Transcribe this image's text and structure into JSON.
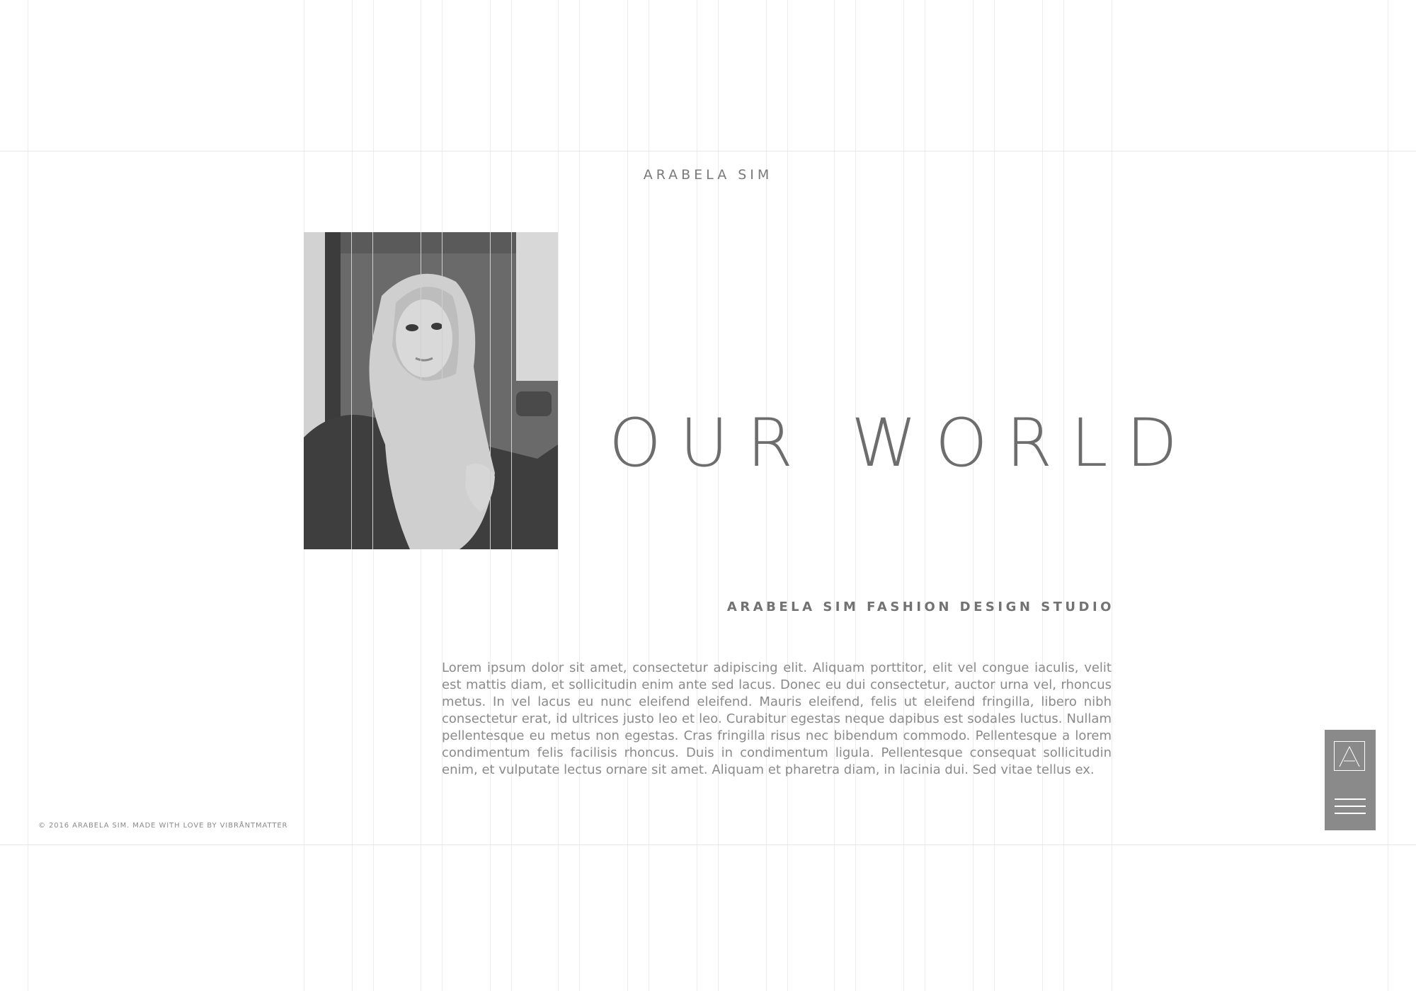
{
  "site": {
    "name": "ARABELA SIM"
  },
  "hero": {
    "headline": "OUR WORLD",
    "subheading": "ARABELA SIM FASHION DESIGN STUDIO",
    "body": "Lorem ipsum dolor sit amet, consectetur adipiscing elit. Aliquam porttitor, elit vel congue iaculis, velit est mattis diam, et sollicitudin enim ante sed lacus. Donec eu dui consectetur, auctor urna vel, rhoncus metus. In vel lacus eu nunc eleifend eleifend. Mauris eleifend, felis ut eleifend fringilla, libero nibh consectetur erat, id ultrices justo leo et leo. Curabitur egestas neque dapibus est sodales luctus. Nullam pellentesque eu metus non egestas. Cras fringilla risus nec bibendum commodo. Pellentesque a lorem condimentum felis facilisis rhoncus. Duis in condimentum ligula. Pellentesque consequat sollicitudin enim, et vulputate lectus ornare sit amet. Aliquam et pharetra diam, in lacinia dui. Sed vitae tellus ex."
  },
  "footer": {
    "copyright": "© 2016 ARABELA SIM. MADE WITH LOVE BY VIBRÅNTMATTER"
  },
  "menu_widget": {
    "logo_icon": "triangle-a-logo-icon",
    "menu_icon": "hamburger-menu-icon"
  },
  "colors": {
    "background": "#ffffff",
    "gridline": "#ececec",
    "text": "#6f6f6f",
    "widget": "#8a8a8a"
  }
}
